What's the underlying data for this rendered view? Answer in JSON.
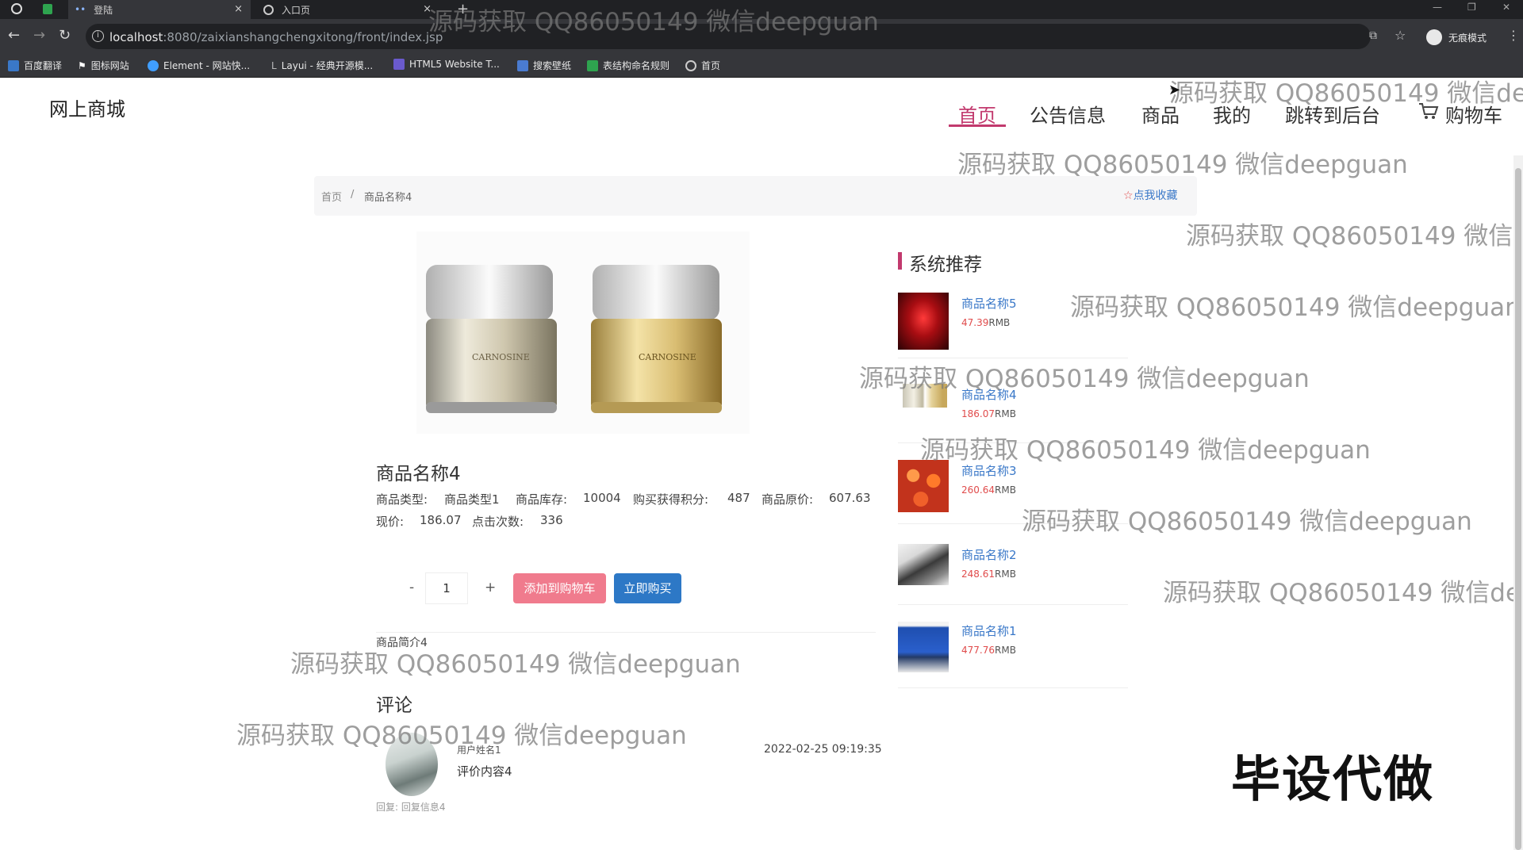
{
  "browser": {
    "tabs": [
      {
        "title": "登陆"
      },
      {
        "title": "入口页"
      }
    ],
    "new_tab": "+",
    "url_host": "localhost",
    "url_rest": ":8080/zaixianshangchengxitong/front/index.jsp",
    "profile_label": "无痕模式",
    "bookmarks": [
      {
        "label": "百度翻译",
        "color": "#3a78c8"
      },
      {
        "label": "图标网站",
        "color": "#ffffff"
      },
      {
        "label": "Element - 网站快...",
        "color": "#409eff"
      },
      {
        "label": "Layui - 经典开源模...",
        "color": "#bbbbbb"
      },
      {
        "label": "HTML5 Website T...",
        "color": "#6a5acd"
      },
      {
        "label": "搜索壁纸",
        "color": "#4a7bd0"
      },
      {
        "label": "表结构命名规则",
        "color": "#2ea44f"
      },
      {
        "label": "首页",
        "color": "#cccccc"
      }
    ]
  },
  "header": {
    "logo": "网上商城",
    "nav": [
      "首页",
      "公告信息",
      "商品",
      "我的",
      "跳转到后台",
      "购物车"
    ]
  },
  "breadcrumb": {
    "home": "首页",
    "sep": "/",
    "current": "商品名称4",
    "favorite": "点我收藏"
  },
  "product": {
    "name": "商品名称4",
    "type_label": "商品类型:",
    "type_value": "商品类型1",
    "stock_label": "商品库存:",
    "stock_value": "10004",
    "points_label": "购买获得积分:",
    "points_value": "487",
    "orig_price_label": "商品原价:",
    "orig_price_value": "607.63",
    "price_label": "现价:",
    "price_value": "186.07",
    "clicks_label": "点击次数:",
    "clicks_value": "336",
    "image_text": "CARNOSINE",
    "qty_minus": "-",
    "qty_value": "1",
    "qty_plus": "+",
    "add_cart": "添加到购物车",
    "buy_now": "立即购买",
    "description": "商品简介4"
  },
  "comments": {
    "title": "评论",
    "items": [
      {
        "user": "用户姓名1",
        "content": "评价内容4",
        "date": "2022-02-25 09:19:35",
        "reply": "回复: 回复信息4"
      }
    ]
  },
  "recommend": {
    "title": "系统推荐",
    "items": [
      {
        "name": "商品名称5",
        "price": "47.39",
        "unit": "RMB"
      },
      {
        "name": "商品名称4",
        "price": "186.07",
        "unit": "RMB"
      },
      {
        "name": "商品名称3",
        "price": "260.64",
        "unit": "RMB"
      },
      {
        "name": "商品名称2",
        "price": "248.61",
        "unit": "RMB"
      },
      {
        "name": "商品名称1",
        "price": "477.76",
        "unit": "RMB"
      }
    ]
  },
  "watermark": "源码获取 QQ86050149 微信deepguan",
  "watermark_partials": [
    "源码获取 QQ86050149 微信dee",
    "源码获取 QQ86050149 微信de",
    "源码获取 QQ86050149 微信deep"
  ],
  "stamp": "毕设代做"
}
